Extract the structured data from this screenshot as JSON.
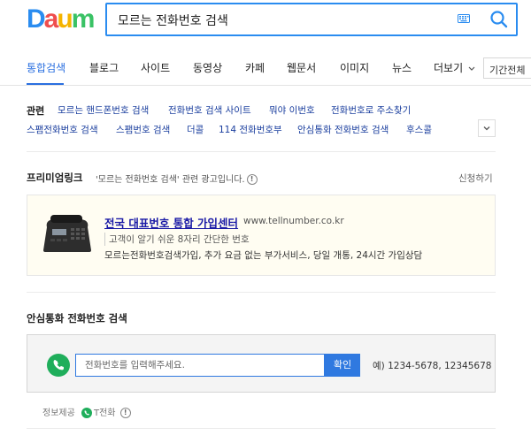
{
  "logo": {
    "letters": [
      "D",
      "a",
      "u",
      "m"
    ],
    "colors": [
      "#2a8cf0",
      "#ef4e4e",
      "#f5b400",
      "#3ac265"
    ]
  },
  "search": {
    "query": "모르는 전화번호 검색"
  },
  "tabs": {
    "items": [
      "통합검색",
      "블로그",
      "사이트",
      "동영상",
      "카페",
      "웹문서",
      "이미지",
      "뉴스",
      "더보기"
    ],
    "active": "통합검색",
    "period": "기간전체"
  },
  "related": {
    "title": "관련",
    "links": [
      "모르는 핸드폰번호 검색",
      "전화번호 검색 사이트",
      "뭐야 이번호",
      "전화번호로 주소찾기",
      "스팸전화번호 검색",
      "스팸번호 검색",
      "더콜",
      "114 전화번호부",
      "안심통화 전화번호 검색",
      "후스콜"
    ]
  },
  "premium": {
    "title": "프리미엄링크",
    "desc": "'모르는 전화번호 검색' 관련 광고입니다.",
    "apply": "신청하기",
    "ad": {
      "title": "전국 대표번호 통합 가입센터",
      "url": "www.tellnumber.co.kr",
      "sub": "고객이 알기 쉬운 8자리 간단한 번호",
      "desc": "모르는전화번호검색가입, 추가 요금 없는 부가서비스, 당일 개통, 24시간 가입상담"
    }
  },
  "safe_call": {
    "title": "안심통화 전화번호 검색",
    "placeholder": "전화번호를 입력해주세요.",
    "button": "확인",
    "example": "예) 1234-5678, 12345678",
    "provider_label": "정보제공",
    "provider_name": "T전화"
  },
  "colors": {
    "accent": "#2a6fe0",
    "search_border": "#2a8cf0",
    "phone_green": "#1fae5b"
  }
}
